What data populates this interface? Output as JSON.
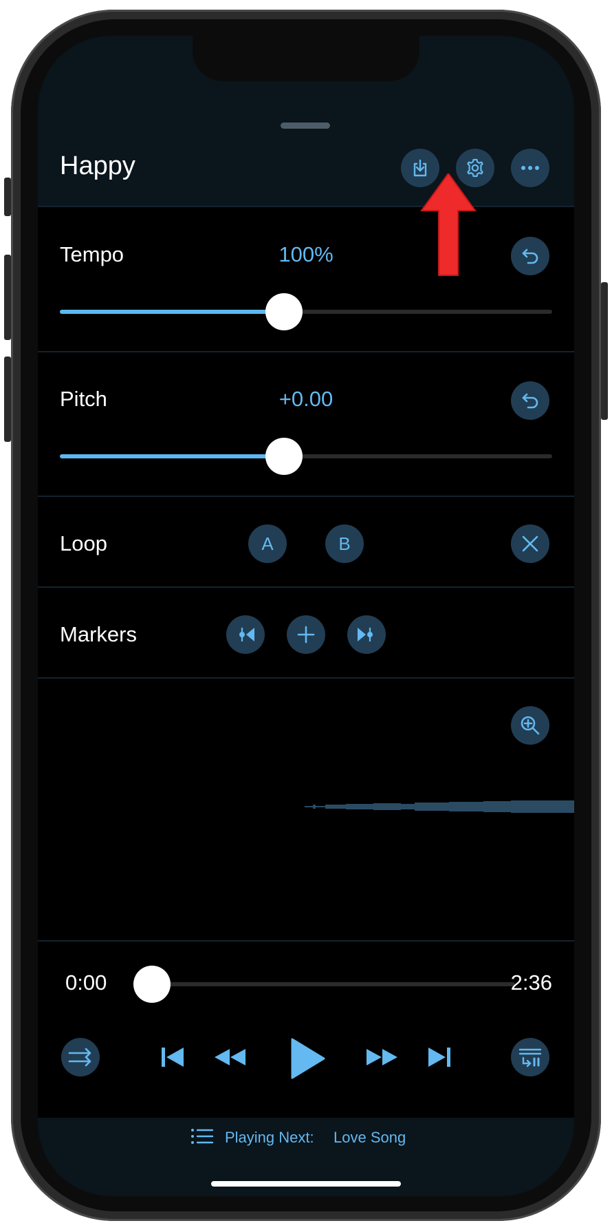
{
  "header": {
    "title": "Happy"
  },
  "tempo": {
    "label": "Tempo",
    "value": "100%",
    "level": 0.5
  },
  "pitch": {
    "label": "Pitch",
    "value": "+0.00",
    "level": 0.5
  },
  "loop": {
    "label": "Loop",
    "a_label": "A",
    "b_label": "B"
  },
  "markers": {
    "label": "Markers"
  },
  "playback": {
    "current_time": "0:00",
    "total_time": "2:36",
    "progress": 0.0
  },
  "footer": {
    "playing_next_label": "Playing Next:",
    "playing_next_song": "Love Song"
  },
  "colors": {
    "accent": "#63b9f0",
    "button_bg": "#223e54",
    "annotation_arrow": "#ee2a2a"
  },
  "icons": [
    "download-icon",
    "gear-icon",
    "more-icon",
    "undo-icon",
    "close-icon",
    "previous-marker-icon",
    "plus-icon",
    "next-marker-icon",
    "zoom-in-icon",
    "shuffle-icon",
    "skip-back-icon",
    "rewind-icon",
    "play-icon",
    "fast-forward-icon",
    "skip-forward-icon",
    "queue-icon",
    "list-icon"
  ]
}
